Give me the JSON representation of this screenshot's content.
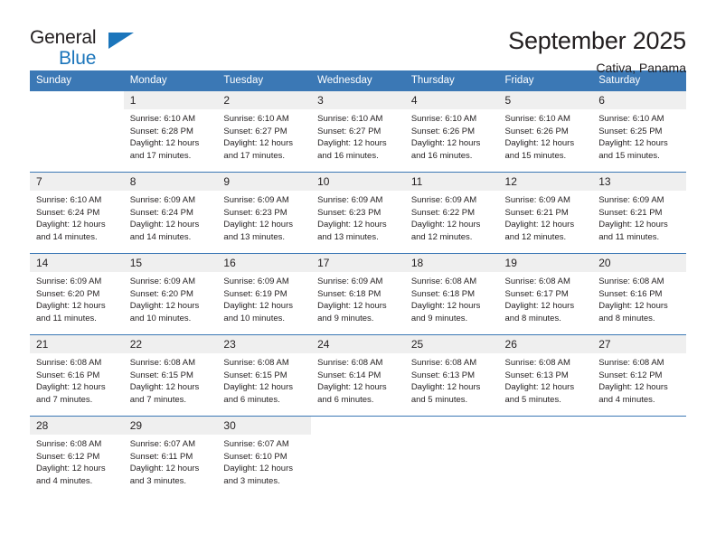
{
  "brand": {
    "name_part1": "General",
    "name_part2": "Blue",
    "triangle_color": "#1b75bb",
    "icon": "triangle-logo-icon"
  },
  "header": {
    "title": "September 2025",
    "subtitle": "Cativa, Panama"
  },
  "colors": {
    "header_blue": "#3b78b5",
    "daynum_bg": "#efefef",
    "text": "#231f20"
  },
  "calendar": {
    "weekday_headers": [
      "Sunday",
      "Monday",
      "Tuesday",
      "Wednesday",
      "Thursday",
      "Friday",
      "Saturday"
    ],
    "labels": {
      "sunrise": "Sunrise:",
      "sunset": "Sunset:",
      "daylight": "Daylight:"
    },
    "weeks": [
      [
        {
          "day": "",
          "empty": true
        },
        {
          "day": "1",
          "sunrise": "Sunrise: 6:10 AM",
          "sunset": "Sunset: 6:28 PM",
          "daylight_l1": "Daylight: 12 hours",
          "daylight_l2": "and 17 minutes."
        },
        {
          "day": "2",
          "sunrise": "Sunrise: 6:10 AM",
          "sunset": "Sunset: 6:27 PM",
          "daylight_l1": "Daylight: 12 hours",
          "daylight_l2": "and 17 minutes."
        },
        {
          "day": "3",
          "sunrise": "Sunrise: 6:10 AM",
          "sunset": "Sunset: 6:27 PM",
          "daylight_l1": "Daylight: 12 hours",
          "daylight_l2": "and 16 minutes."
        },
        {
          "day": "4",
          "sunrise": "Sunrise: 6:10 AM",
          "sunset": "Sunset: 6:26 PM",
          "daylight_l1": "Daylight: 12 hours",
          "daylight_l2": "and 16 minutes."
        },
        {
          "day": "5",
          "sunrise": "Sunrise: 6:10 AM",
          "sunset": "Sunset: 6:26 PM",
          "daylight_l1": "Daylight: 12 hours",
          "daylight_l2": "and 15 minutes."
        },
        {
          "day": "6",
          "sunrise": "Sunrise: 6:10 AM",
          "sunset": "Sunset: 6:25 PM",
          "daylight_l1": "Daylight: 12 hours",
          "daylight_l2": "and 15 minutes."
        }
      ],
      [
        {
          "day": "7",
          "sunrise": "Sunrise: 6:10 AM",
          "sunset": "Sunset: 6:24 PM",
          "daylight_l1": "Daylight: 12 hours",
          "daylight_l2": "and 14 minutes."
        },
        {
          "day": "8",
          "sunrise": "Sunrise: 6:09 AM",
          "sunset": "Sunset: 6:24 PM",
          "daylight_l1": "Daylight: 12 hours",
          "daylight_l2": "and 14 minutes."
        },
        {
          "day": "9",
          "sunrise": "Sunrise: 6:09 AM",
          "sunset": "Sunset: 6:23 PM",
          "daylight_l1": "Daylight: 12 hours",
          "daylight_l2": "and 13 minutes."
        },
        {
          "day": "10",
          "sunrise": "Sunrise: 6:09 AM",
          "sunset": "Sunset: 6:23 PM",
          "daylight_l1": "Daylight: 12 hours",
          "daylight_l2": "and 13 minutes."
        },
        {
          "day": "11",
          "sunrise": "Sunrise: 6:09 AM",
          "sunset": "Sunset: 6:22 PM",
          "daylight_l1": "Daylight: 12 hours",
          "daylight_l2": "and 12 minutes."
        },
        {
          "day": "12",
          "sunrise": "Sunrise: 6:09 AM",
          "sunset": "Sunset: 6:21 PM",
          "daylight_l1": "Daylight: 12 hours",
          "daylight_l2": "and 12 minutes."
        },
        {
          "day": "13",
          "sunrise": "Sunrise: 6:09 AM",
          "sunset": "Sunset: 6:21 PM",
          "daylight_l1": "Daylight: 12 hours",
          "daylight_l2": "and 11 minutes."
        }
      ],
      [
        {
          "day": "14",
          "sunrise": "Sunrise: 6:09 AM",
          "sunset": "Sunset: 6:20 PM",
          "daylight_l1": "Daylight: 12 hours",
          "daylight_l2": "and 11 minutes."
        },
        {
          "day": "15",
          "sunrise": "Sunrise: 6:09 AM",
          "sunset": "Sunset: 6:20 PM",
          "daylight_l1": "Daylight: 12 hours",
          "daylight_l2": "and 10 minutes."
        },
        {
          "day": "16",
          "sunrise": "Sunrise: 6:09 AM",
          "sunset": "Sunset: 6:19 PM",
          "daylight_l1": "Daylight: 12 hours",
          "daylight_l2": "and 10 minutes."
        },
        {
          "day": "17",
          "sunrise": "Sunrise: 6:09 AM",
          "sunset": "Sunset: 6:18 PM",
          "daylight_l1": "Daylight: 12 hours",
          "daylight_l2": "and 9 minutes."
        },
        {
          "day": "18",
          "sunrise": "Sunrise: 6:08 AM",
          "sunset": "Sunset: 6:18 PM",
          "daylight_l1": "Daylight: 12 hours",
          "daylight_l2": "and 9 minutes."
        },
        {
          "day": "19",
          "sunrise": "Sunrise: 6:08 AM",
          "sunset": "Sunset: 6:17 PM",
          "daylight_l1": "Daylight: 12 hours",
          "daylight_l2": "and 8 minutes."
        },
        {
          "day": "20",
          "sunrise": "Sunrise: 6:08 AM",
          "sunset": "Sunset: 6:16 PM",
          "daylight_l1": "Daylight: 12 hours",
          "daylight_l2": "and 8 minutes."
        }
      ],
      [
        {
          "day": "21",
          "sunrise": "Sunrise: 6:08 AM",
          "sunset": "Sunset: 6:16 PM",
          "daylight_l1": "Daylight: 12 hours",
          "daylight_l2": "and 7 minutes."
        },
        {
          "day": "22",
          "sunrise": "Sunrise: 6:08 AM",
          "sunset": "Sunset: 6:15 PM",
          "daylight_l1": "Daylight: 12 hours",
          "daylight_l2": "and 7 minutes."
        },
        {
          "day": "23",
          "sunrise": "Sunrise: 6:08 AM",
          "sunset": "Sunset: 6:15 PM",
          "daylight_l1": "Daylight: 12 hours",
          "daylight_l2": "and 6 minutes."
        },
        {
          "day": "24",
          "sunrise": "Sunrise: 6:08 AM",
          "sunset": "Sunset: 6:14 PM",
          "daylight_l1": "Daylight: 12 hours",
          "daylight_l2": "and 6 minutes."
        },
        {
          "day": "25",
          "sunrise": "Sunrise: 6:08 AM",
          "sunset": "Sunset: 6:13 PM",
          "daylight_l1": "Daylight: 12 hours",
          "daylight_l2": "and 5 minutes."
        },
        {
          "day": "26",
          "sunrise": "Sunrise: 6:08 AM",
          "sunset": "Sunset: 6:13 PM",
          "daylight_l1": "Daylight: 12 hours",
          "daylight_l2": "and 5 minutes."
        },
        {
          "day": "27",
          "sunrise": "Sunrise: 6:08 AM",
          "sunset": "Sunset: 6:12 PM",
          "daylight_l1": "Daylight: 12 hours",
          "daylight_l2": "and 4 minutes."
        }
      ],
      [
        {
          "day": "28",
          "sunrise": "Sunrise: 6:08 AM",
          "sunset": "Sunset: 6:12 PM",
          "daylight_l1": "Daylight: 12 hours",
          "daylight_l2": "and 4 minutes."
        },
        {
          "day": "29",
          "sunrise": "Sunrise: 6:07 AM",
          "sunset": "Sunset: 6:11 PM",
          "daylight_l1": "Daylight: 12 hours",
          "daylight_l2": "and 3 minutes."
        },
        {
          "day": "30",
          "sunrise": "Sunrise: 6:07 AM",
          "sunset": "Sunset: 6:10 PM",
          "daylight_l1": "Daylight: 12 hours",
          "daylight_l2": "and 3 minutes."
        },
        {
          "day": "",
          "empty": true
        },
        {
          "day": "",
          "empty": true
        },
        {
          "day": "",
          "empty": true
        },
        {
          "day": "",
          "empty": true
        }
      ]
    ]
  }
}
